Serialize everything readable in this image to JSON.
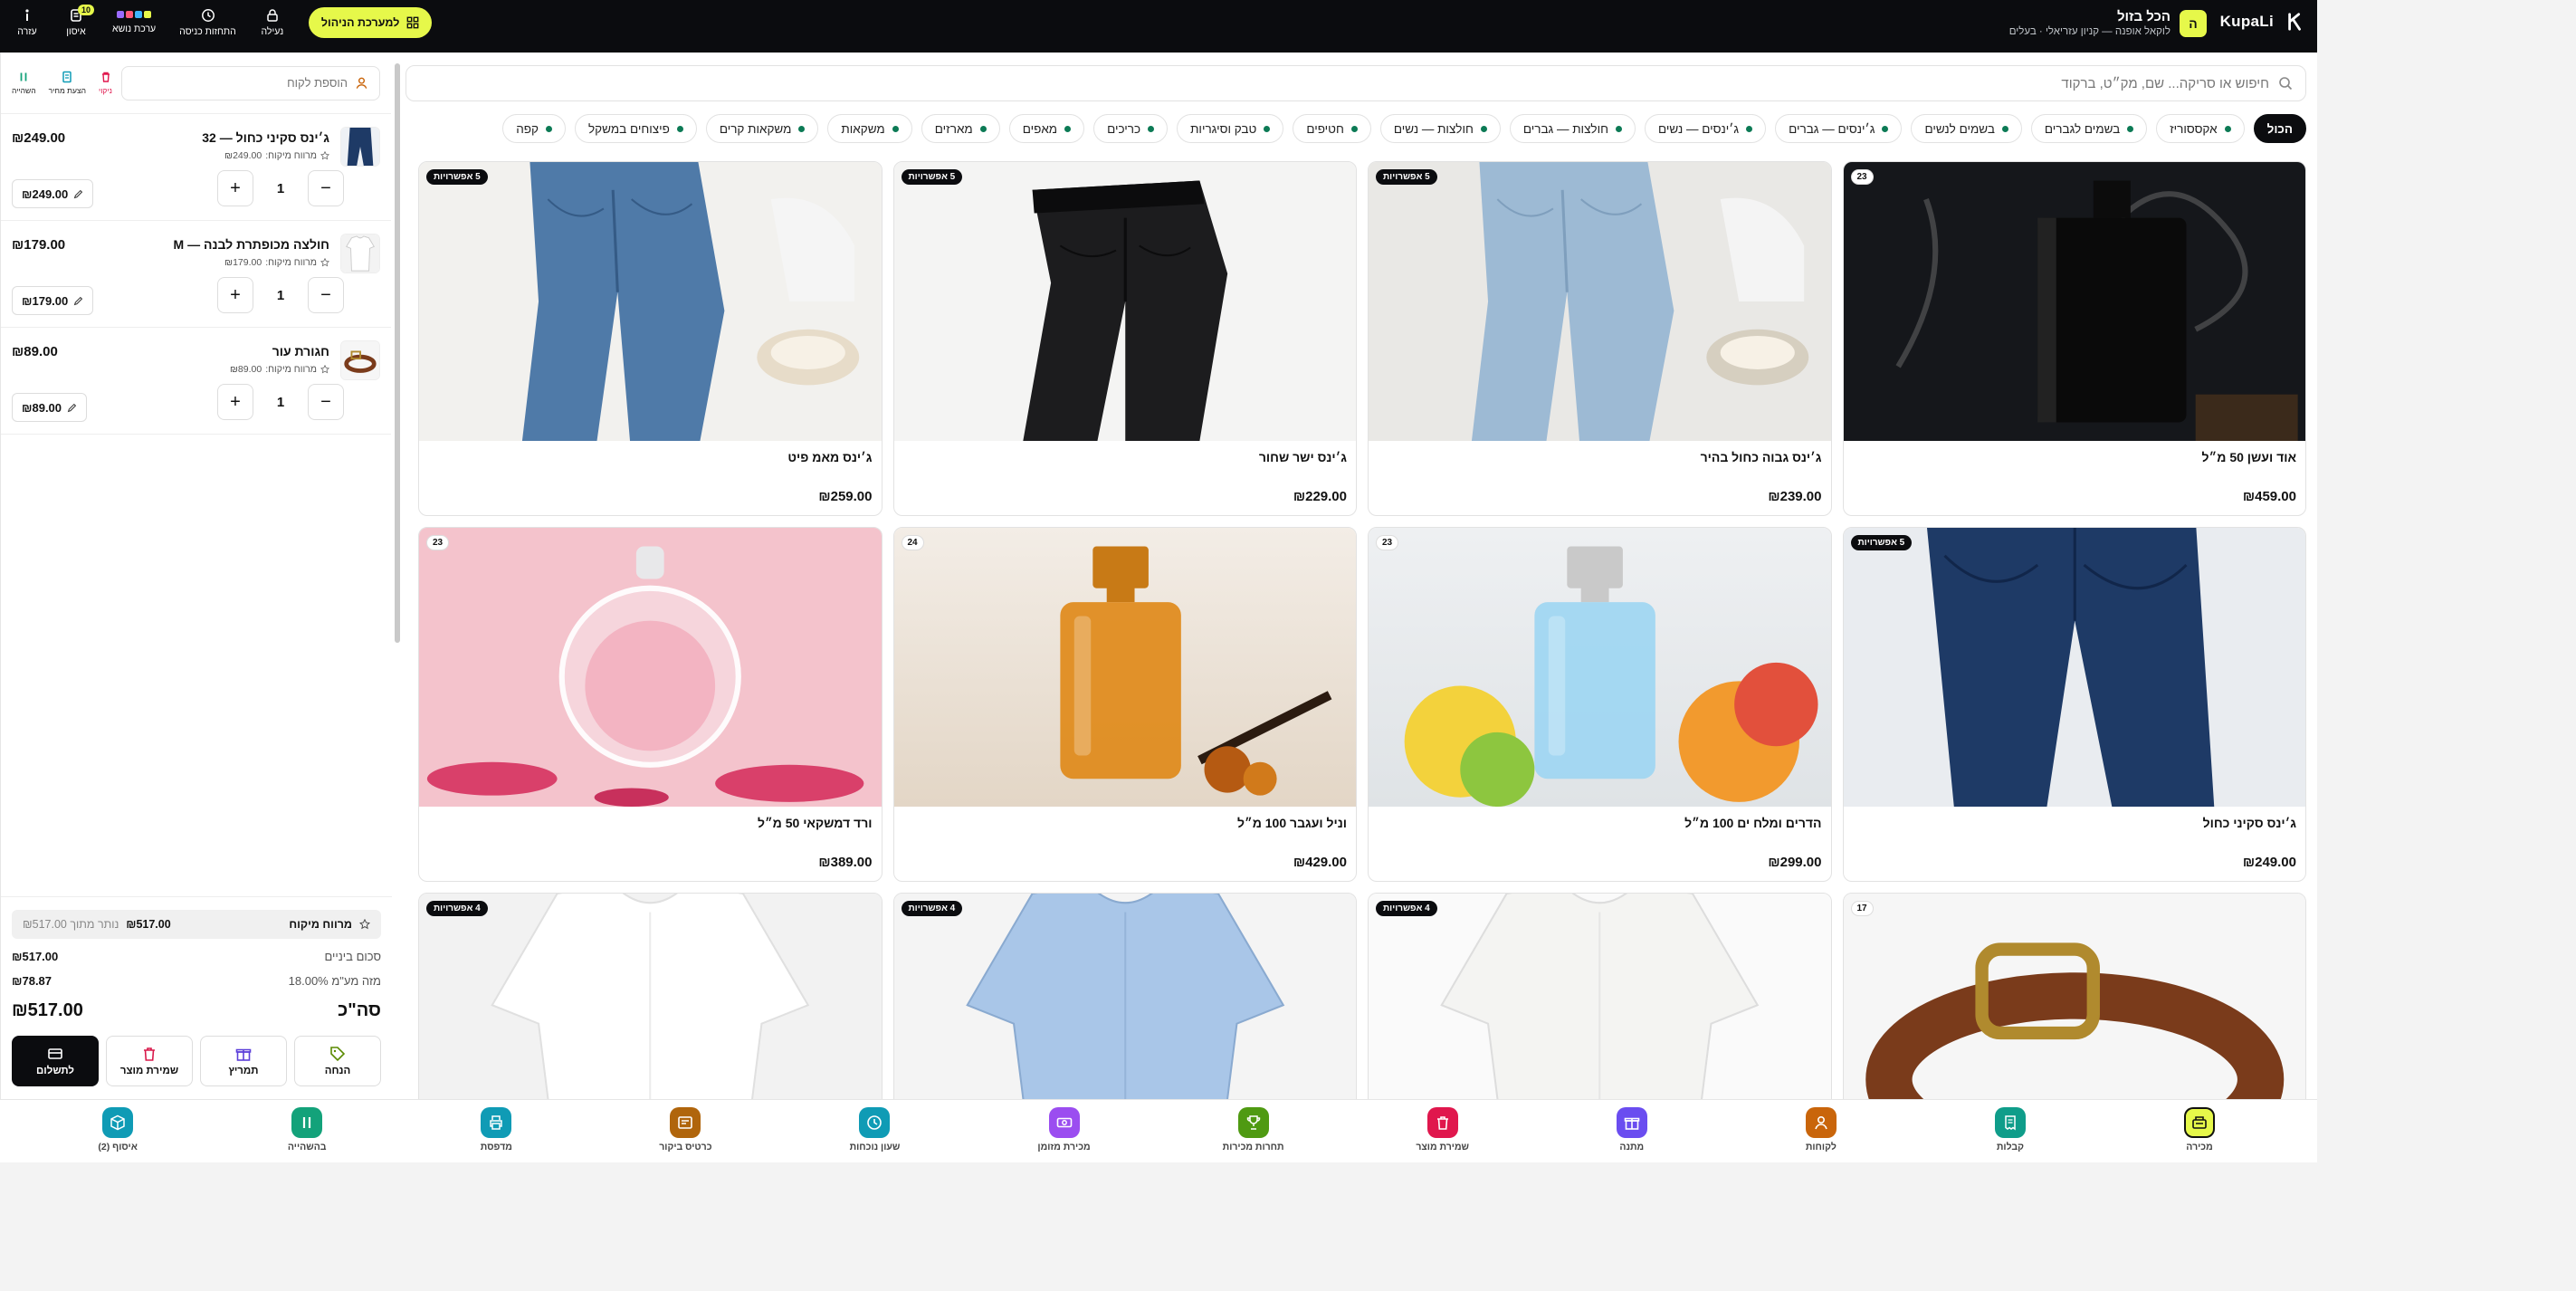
{
  "topbar": {
    "brand": "KupaLi",
    "store_initial": "ה",
    "store_title": "הכל בזול",
    "store_subtitle": "לוקאל אופנה — קניון עזריאלי · בעלים",
    "tools": [
      {
        "label": "עזרה",
        "icon": "help-icon"
      },
      {
        "label": "איסון",
        "icon": "queue-icon",
        "badge": "10"
      },
      {
        "label": "ערכת נושא",
        "icon": "theme-icon"
      },
      {
        "label": "התחזות כניסה",
        "icon": "clock-icon"
      },
      {
        "label": "נעילה",
        "icon": "lock-icon"
      }
    ],
    "manager_btn": "למערכת הניהול",
    "colors": {
      "accent": "#e6f84a",
      "dark": "#0b0c0f",
      "green": "#0c7a55"
    }
  },
  "cart": {
    "customer_placeholder": "הוספת לקוח",
    "mini_tools": [
      {
        "label": "השהייה",
        "icon": "pause-icon"
      },
      {
        "label": "הצעת מחיר",
        "icon": "quote-icon"
      },
      {
        "label": "ניקוי",
        "icon": "trash-icon"
      }
    ],
    "lines": [
      {
        "name": "ג׳ינס סקיני כחול — 32",
        "sub": "מרווח מיקוח:",
        "sub_value": "₪249.00",
        "price": "₪249.00",
        "qty": "1",
        "chip": "₪249.00",
        "thumb": "jeans"
      },
      {
        "name": "חולצה מכופתרת לבנה — M",
        "sub": "מרווח מיקוח:",
        "sub_value": "₪179.00",
        "price": "₪179.00",
        "qty": "1",
        "chip": "₪179.00",
        "thumb": "shirt"
      },
      {
        "name": "חגורת עור",
        "sub": "מרווח מיקוח:",
        "sub_value": "₪89.00",
        "price": "₪89.00",
        "qty": "1",
        "chip": "₪89.00",
        "thumb": "belt"
      }
    ],
    "margin_label": "מרווח מיקוח",
    "margin_value": "₪517.00",
    "margin_left": "נותר מתוך ₪517.00",
    "subtotal_label": "סכום ביניים",
    "subtotal_value": "₪517.00",
    "vat_label": "מזה מע\"מ 18.00%",
    "vat_value": "₪78.87",
    "total_label": "סה\"כ",
    "total_value": "₪517.00",
    "actions": [
      {
        "label": "הנחה",
        "icon": "tag-icon",
        "color": "#5a8a00"
      },
      {
        "label": "תמריץ",
        "icon": "gift-icon",
        "color": "#5b3fd9"
      },
      {
        "label": "שמירת מוצר",
        "icon": "trash-save-icon",
        "color": "#d9184a"
      },
      {
        "label": "לתשלום",
        "icon": "card-icon",
        "color": "#ffffff"
      }
    ]
  },
  "search": {
    "placeholder": "חיפוש או סריקה... שם, מק״ט, ברקוד"
  },
  "categories": [
    "הכול",
    "אקססוריז",
    "בשמים לגברים",
    "בשמים לנשים",
    "ג׳ינסים — גברים",
    "ג׳ינסים — נשים",
    "חולצות — גברים",
    "חולצות — נשים",
    "חטיפים",
    "טבק וסיגריות",
    "כריכים",
    "מאפים",
    "מארזים",
    "משקאות",
    "משקאות קרים",
    "פיצוחים במשקל",
    "קפה"
  ],
  "products": [
    {
      "name": "אוד ועשן 50 מ״ל",
      "price": "₪459.00",
      "badge": "23",
      "badge_type": "stock",
      "img": "oud"
    },
    {
      "name": "ג׳ינס גבוה כחול בהיר",
      "price": "₪239.00",
      "badge": "5 אפשרויות",
      "badge_type": "options",
      "img": "lightjeans"
    },
    {
      "name": "ג׳ינס ישר שחור",
      "price": "₪229.00",
      "badge": "5 אפשרויות",
      "badge_type": "options",
      "img": "blackjeans"
    },
    {
      "name": "ג׳ינס מאמ פיט",
      "price": "₪259.00",
      "badge": "5 אפשרויות",
      "badge_type": "options",
      "img": "momjeans"
    },
    {
      "name": "ג׳ינס סקיני כחול",
      "price": "₪249.00",
      "badge": "5 אפשרויות",
      "badge_type": "options",
      "img": "skinny"
    },
    {
      "name": "הדרים ומלח ים 100 מ״ל",
      "price": "₪299.00",
      "badge": "23",
      "badge_type": "stock",
      "img": "citrus"
    },
    {
      "name": "וניל ועגבר 100 מ״ל",
      "price": "₪429.00",
      "badge": "24",
      "badge_type": "stock",
      "img": "vanilla"
    },
    {
      "name": "ורד דמשקאי 50 מ״ל",
      "price": "₪389.00",
      "badge": "23",
      "badge_type": "stock",
      "img": "rose"
    },
    {
      "name": "",
      "price": "",
      "badge": "17",
      "badge_type": "stock",
      "img": "belt"
    },
    {
      "name": "",
      "price": "",
      "badge": "4 אפשרויות",
      "badge_type": "options",
      "img": "whiteshirt"
    },
    {
      "name": "",
      "price": "",
      "badge": "4 אפשרויות",
      "badge_type": "options",
      "img": "blueshirt"
    },
    {
      "name": "",
      "price": "",
      "badge": "4 אפשרויות",
      "badge_type": "options",
      "img": "tshirt"
    }
  ],
  "bottom_nav": [
    {
      "label": "מכירה",
      "icon": "register-icon",
      "color": "#e6f84a",
      "active": true
    },
    {
      "label": "קבלות",
      "icon": "receipt-icon",
      "color": "#0f9d8a"
    },
    {
      "label": "לקוחות",
      "icon": "user-icon",
      "color": "#c9650b"
    },
    {
      "label": "מתנה",
      "icon": "gift-icon",
      "color": "#6a4df0"
    },
    {
      "label": "שמירת מוצר",
      "icon": "trash-icon",
      "color": "#e0174d"
    },
    {
      "label": "תחרות מכירות",
      "icon": "trophy-icon",
      "color": "#4f9a12"
    },
    {
      "label": "מכירת מזומן",
      "icon": "cash-icon",
      "color": "#9b4df0"
    },
    {
      "label": "שעון נוכחות",
      "icon": "clock-icon",
      "color": "#0f9bb5"
    },
    {
      "label": "כרטיס ביקור",
      "icon": "card-icon",
      "color": "#b0650c"
    },
    {
      "label": "מדפסת",
      "icon": "printer-icon",
      "color": "#0f9bb5"
    },
    {
      "label": "בהשהייה",
      "icon": "pause-icon",
      "color": "#13a27a"
    },
    {
      "label": "איסוף (2)",
      "icon": "box-icon",
      "color": "#0f9bb5"
    }
  ]
}
